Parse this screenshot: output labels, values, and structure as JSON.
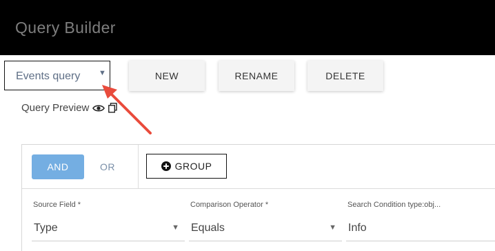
{
  "window": {
    "title": "Query Builder"
  },
  "query_selector": {
    "value": "Events query",
    "caret": "▼"
  },
  "toolbar": {
    "new_label": "NEW",
    "rename_label": "RENAME",
    "delete_label": "DELETE"
  },
  "preview": {
    "label": "Query Preview"
  },
  "builder": {
    "and_label": "AND",
    "or_label": "OR",
    "group_label": "GROUP",
    "fields": [
      {
        "label": "Source Field *",
        "value": "Type"
      },
      {
        "label": "Comparison Operator *",
        "value": "Equals"
      },
      {
        "label": "Search Condition type:obj...",
        "value": "Info"
      }
    ]
  },
  "colors": {
    "titlebar": "#000000",
    "and_active": "#74aee2",
    "annotation_arrow": "#e94b3c"
  }
}
